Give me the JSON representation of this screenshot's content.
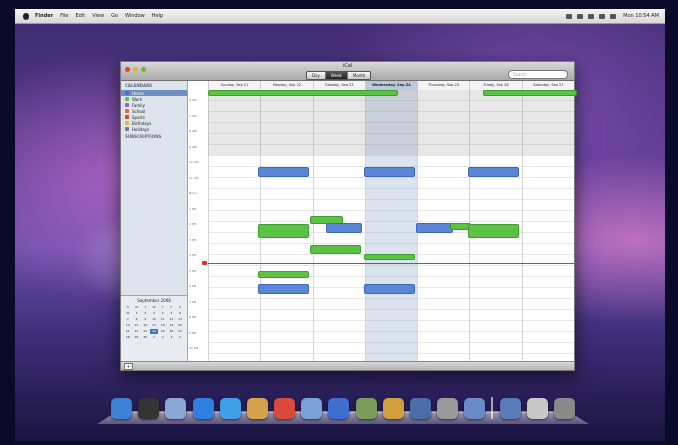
{
  "menubar": {
    "app_name": "Finder",
    "items": [
      "File",
      "Edit",
      "View",
      "Go",
      "Window",
      "Help"
    ],
    "clock": "Mon 10:54 AM"
  },
  "window": {
    "title": "iCal",
    "view_buttons": [
      "Day",
      "Week",
      "Month"
    ],
    "active_view": "Week",
    "search_placeholder": "Search"
  },
  "sidebar": {
    "header": "CALENDARS",
    "calendars": [
      {
        "label": "Home",
        "color": "#3f75c8",
        "selected": true
      },
      {
        "label": "Work",
        "color": "#5bc246",
        "selected": false
      },
      {
        "label": "Family",
        "color": "#a25bd8",
        "selected": false
      },
      {
        "label": "School",
        "color": "#e0732b",
        "selected": false
      },
      {
        "label": "Sports",
        "color": "#d6443a",
        "selected": false
      },
      {
        "label": "Birthdays",
        "color": "#e0c12b",
        "selected": false
      },
      {
        "label": "Holidays",
        "color": "#7a7a7a",
        "selected": false
      }
    ],
    "group_header": "SUBSCRIPTIONS"
  },
  "minical": {
    "title": "September 2008",
    "days": [
      "S",
      "M",
      "T",
      "W",
      "T",
      "F",
      "S",
      "31",
      "1",
      "2",
      "3",
      "4",
      "5",
      "6",
      "7",
      "8",
      "9",
      "10",
      "11",
      "12",
      "13",
      "14",
      "15",
      "16",
      "17",
      "18",
      "19",
      "20",
      "21",
      "22",
      "23",
      "24",
      "25",
      "26",
      "27",
      "28",
      "29",
      "30",
      "1",
      "2",
      "3",
      "4"
    ],
    "today_index": 24
  },
  "week": {
    "days": [
      "Sunday, Sep 21",
      "Monday, Sep 22",
      "Tuesday, Sep 23",
      "Wednesday, Sep 24",
      "Thursday, Sep 25",
      "Friday, Sep 26",
      "Saturday, Sep 27"
    ],
    "today_index": 3,
    "hours": [
      "6 AM",
      "7 AM",
      "8 AM",
      "9 AM",
      "10 AM",
      "11 AM",
      "Noon",
      "1 PM",
      "2 PM",
      "3 PM",
      "4 PM",
      "5 PM",
      "6 PM",
      "7 PM",
      "8 PM",
      "9 PM",
      "10 PM",
      "11 PM"
    ]
  },
  "dock": {
    "icons": [
      "finder-icon",
      "dashboard-icon",
      "mail-icon",
      "safari-icon",
      "ichat-icon",
      "address-book-icon",
      "ical-icon",
      "preview-icon",
      "itunes-icon",
      "iphoto-icon",
      "garageband-icon",
      "time-machine-icon",
      "system-preferences-icon",
      "spaces-icon",
      "documents-icon",
      "downloads-icon",
      "trash-icon"
    ],
    "colors": [
      "#3b82d6",
      "#333333",
      "#8aa7d4",
      "#2f7fe0",
      "#3fa0e8",
      "#d8a24a",
      "#d84a3a",
      "#7aa2d8",
      "#3c6fd0",
      "#7a9e5a",
      "#d0a040",
      "#4a6ca8",
      "#9a9a9a",
      "#6a8ac8",
      "#5a7ab8",
      "#c8c8c8",
      "#8a8a8a"
    ]
  }
}
